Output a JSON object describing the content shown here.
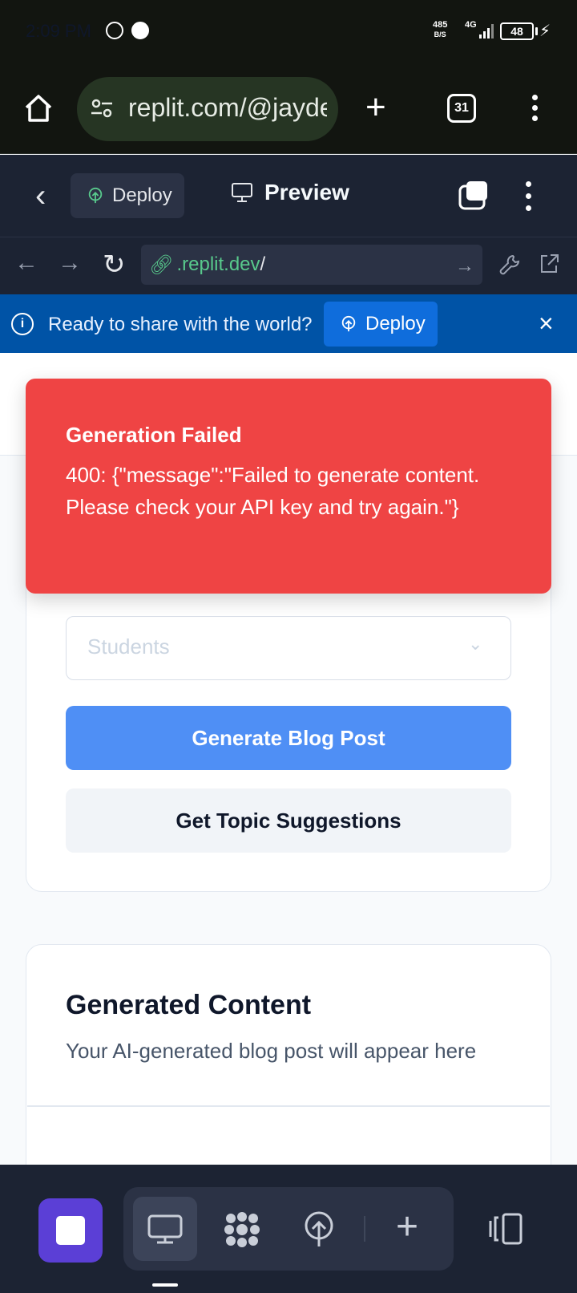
{
  "status_bar": {
    "time": "2:09 PM",
    "net_speed_value": "485",
    "net_speed_unit": "B/S",
    "network_type": "4G",
    "battery": "48"
  },
  "browser": {
    "url": "replit.com/@jayde",
    "tab_count": "31"
  },
  "replit_header": {
    "deploy_label": "Deploy",
    "preview_label": "Preview"
  },
  "webview": {
    "address_domain": ".replit.dev",
    "address_path": "/"
  },
  "banner": {
    "text": "Ready to share with the world?",
    "deploy_label": "Deploy"
  },
  "form": {
    "audience_value": "Students",
    "generate_label": "Generate Blog Post",
    "topics_label": "Get Topic Suggestions"
  },
  "output": {
    "title": "Generated Content",
    "subtitle": "Your AI-generated blog post will appear here"
  },
  "toast": {
    "title": "Generation Failed",
    "message": "400: {\"message\":\"Failed to generate content. Please check your API key and try again.\"}"
  },
  "colors": {
    "toast_bg": "#ef4444",
    "primary_button": "#4f8ff5",
    "replit_dark": "#1c2333",
    "banner_blue": "#0053a6",
    "stop_purple": "#5b3fd6"
  },
  "icons": [
    "home-icon",
    "tune-icon",
    "plus-icon",
    "tabs-icon",
    "kebab-icon",
    "back-icon",
    "deploy-icon",
    "monitor-icon",
    "stack-icon",
    "reload-icon",
    "link-icon",
    "wrench-icon",
    "external-link-icon",
    "info-icon",
    "close-icon",
    "chevron-down-icon",
    "stop-icon",
    "agent-icon"
  ]
}
